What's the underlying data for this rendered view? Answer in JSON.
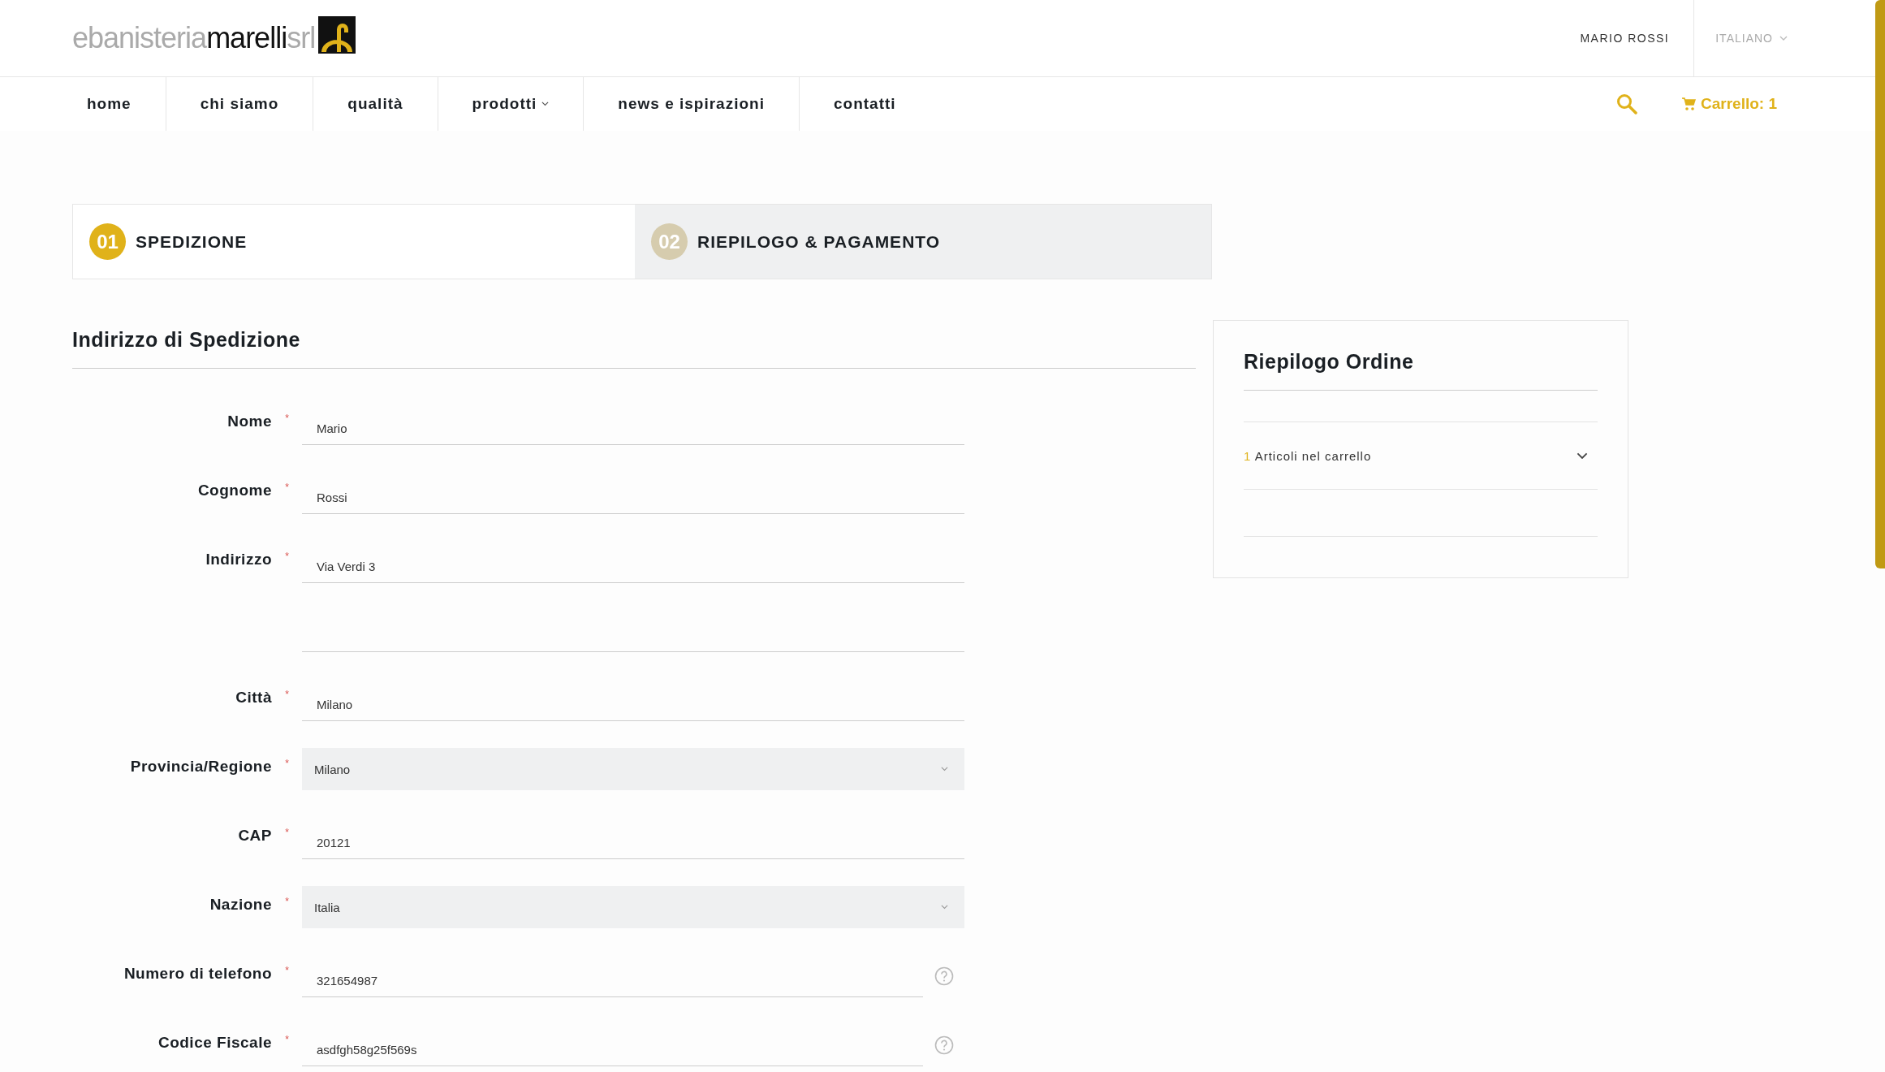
{
  "header": {
    "logo": "ebanisteria**marelli**srl",
    "user": "MARIO ROSSI",
    "language": "ITALIANO"
  },
  "nav": {
    "items": [
      {
        "label": "home",
        "dropdown": false
      },
      {
        "label": "chi siamo",
        "dropdown": false
      },
      {
        "label": "qualità",
        "dropdown": false
      },
      {
        "label": "prodotti",
        "dropdown": true
      },
      {
        "label": "news e ispirazioni",
        "dropdown": false
      },
      {
        "label": "contatti",
        "dropdown": false
      }
    ],
    "cart": "Carrello: 1"
  },
  "steps": [
    {
      "number": "01",
      "label": "SPEDIZIONE",
      "selected": true
    },
    {
      "number": "02",
      "label": "RIEPILOGO & PAGAMENTO",
      "selected": false
    }
  ],
  "form": {
    "title": "Indirizzo di Spedizione",
    "fields": [
      {
        "kind": "text",
        "label": "Nome",
        "mark": "*",
        "value": "Mario"
      },
      {
        "kind": "text",
        "label": "Cognome",
        "mark": "*",
        "value": "Rossi"
      },
      {
        "kind": "text",
        "label": "Indirizzo",
        "mark": "*",
        "value": "Via Verdi 3",
        "extra_line": true
      },
      {
        "kind": "text",
        "label": "Città",
        "mark": "*",
        "value": "Milano"
      },
      {
        "kind": "select",
        "label": "Provincia/Regione",
        "mark": "*",
        "value": "Milano"
      },
      {
        "kind": "text",
        "label": "CAP",
        "mark": "*",
        "value": "20121"
      },
      {
        "kind": "select",
        "label": "Nazione",
        "mark": "*",
        "value": "Italia"
      },
      {
        "kind": "help",
        "label": "Numero di telefono",
        "mark": "*",
        "value": "321654987"
      },
      {
        "kind": "help",
        "label": "Codice Fiscale",
        "mark": "*",
        "value": "asdfgh58g25f569s"
      }
    ]
  },
  "summary": {
    "title": "Riepilogo Ordine",
    "count": "1",
    "items_label": "Articoli nel carrello",
    "expanded": false
  }
}
